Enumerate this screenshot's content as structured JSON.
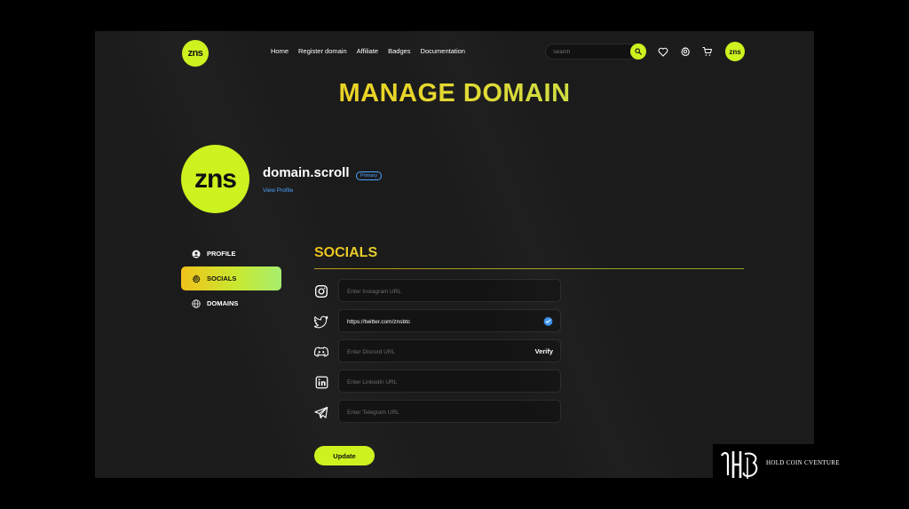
{
  "header": {
    "logo_text": "zns",
    "nav": [
      "Home",
      "Register domain",
      "Affiliate",
      "Badges",
      "Documentation"
    ],
    "search_placeholder": "Search",
    "avatar_text": "zns"
  },
  "page_title": "MANAGE DOMAIN",
  "profile": {
    "logo_text": "zns",
    "domain": "domain.scroll",
    "badge": "Primary",
    "view_profile": "View Profile"
  },
  "sidebar": {
    "items": [
      {
        "label": "PROFILE",
        "icon": "user-icon",
        "active": false
      },
      {
        "label": "SOCIALS",
        "icon": "gear-icon",
        "active": true
      },
      {
        "label": "DOMAINS",
        "icon": "globe-icon",
        "active": false
      }
    ]
  },
  "socials": {
    "title": "SOCIALS",
    "fields": [
      {
        "icon": "instagram-icon",
        "placeholder": "Enter Instagram URL",
        "value": ""
      },
      {
        "icon": "twitter-icon",
        "placeholder": "",
        "value": "https://twitter.com/znsbtc",
        "verified": true
      },
      {
        "icon": "discord-icon",
        "placeholder": "Enter Discord URL",
        "value": "",
        "action": "Verify"
      },
      {
        "icon": "linkedin-icon",
        "placeholder": "Enter Linkedin URL",
        "value": ""
      },
      {
        "icon": "telegram-icon",
        "placeholder": "Enter Telegram URL",
        "value": ""
      }
    ],
    "update_label": "Update"
  },
  "watermark": {
    "text": "HOLD COIN CVENTURE"
  },
  "colors": {
    "accent": "#ccf21f",
    "link": "#4aa3ff",
    "gradient_start": "#f0c419",
    "gradient_end": "#a8e86a"
  }
}
